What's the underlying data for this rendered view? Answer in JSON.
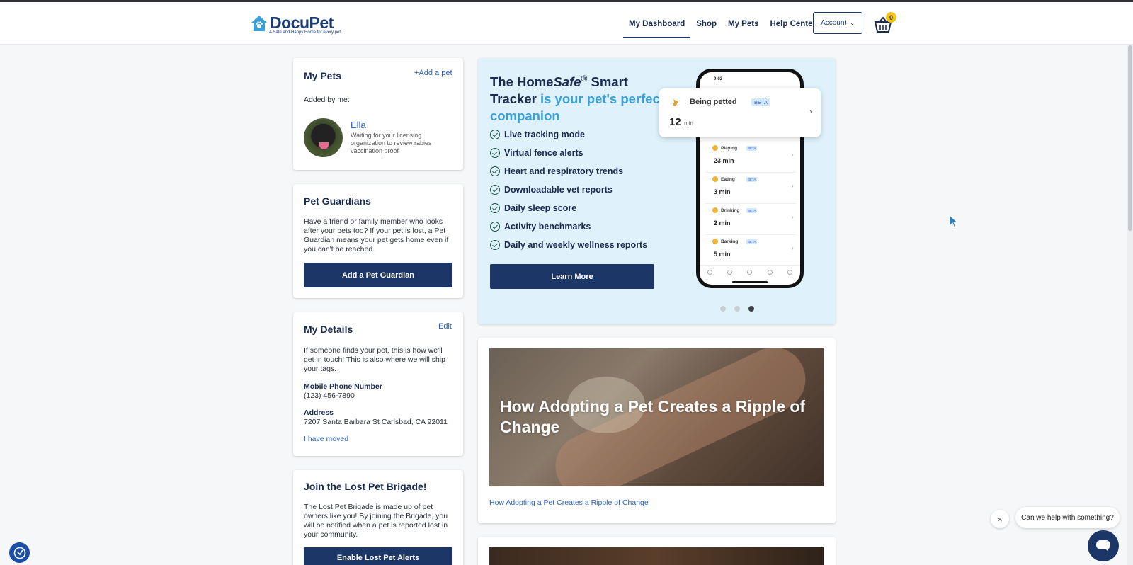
{
  "brand": {
    "name": "DocuPet",
    "tagline": "A Safe and Happy Home for every pet"
  },
  "nav": {
    "items": [
      {
        "label": "My Dashboard",
        "active": true
      },
      {
        "label": "Shop"
      },
      {
        "label": "My Pets"
      },
      {
        "label": "Help Center"
      }
    ],
    "account_label": "Account",
    "cart_count": "0"
  },
  "my_pets": {
    "title": "My Pets",
    "add_link": "+Add a pet",
    "added_by": "Added by me:",
    "pet": {
      "name": "Ella",
      "status": "Waiting for your licensing organization to review rabies vaccination proof"
    }
  },
  "guardians": {
    "title": "Pet Guardians",
    "body": "Have a friend or family member who looks after your pets too? If your pet is lost, a Pet Guardian means your pet gets home even if you can't be reached.",
    "button": "Add a Pet Guardian"
  },
  "details": {
    "title": "My Details",
    "edit": "Edit",
    "body": "If someone finds your pet, this is how we'll get in touch! This is also where we will ship your tags.",
    "phone_label": "Mobile Phone Number",
    "phone": "(123) 456-7890",
    "address_label": "Address",
    "address": "7207 Santa Barbara St Carlsbad, CA 92011",
    "moved_link": "I have moved"
  },
  "brigade": {
    "title": "Join the Lost Pet Brigade!",
    "body": "The Lost Pet Brigade is made up of pet owners like you! By joining the Brigade, you will be notified when a pet is reported lost in your community.",
    "button": "Enable Lost Pet Alerts"
  },
  "promo": {
    "title_1": "The Home",
    "title_italic": "Safe",
    "title_sup": "®",
    "title_2": " Smart Tracker ",
    "title_accent": "is your pet's perfect companion",
    "features": [
      "Live tracking mode",
      "Virtual fence alerts",
      "Heart and respiratory trends",
      "Downloadable vet reports",
      "Daily sleep score",
      "Activity benchmarks",
      "Daily and weekly wellness reports"
    ],
    "button": "Learn More",
    "slide_count": 3,
    "active_slide": 3,
    "phone": {
      "time": "9:02",
      "popup": {
        "label": "Being petted",
        "beta": "BETA",
        "value": "12",
        "unit": "min"
      },
      "rows": [
        {
          "label": "Playing",
          "beta": "BETA",
          "value": "23 min"
        },
        {
          "label": "Eating",
          "beta": "BETA",
          "value": "3 min"
        },
        {
          "label": "Drinking",
          "beta": "BETA",
          "value": "2 min"
        },
        {
          "label": "Barking",
          "beta": "BETA",
          "value": "5 min"
        }
      ]
    }
  },
  "blog": {
    "post1_title": "How Adopting a Pet Creates a Ripple of Change",
    "post1_link": "How Adopting a Pet Creates a Ripple of Change"
  },
  "chat": {
    "prompt": "Can we help with something?"
  },
  "colors": {
    "navy": "#1d3668",
    "link": "#2c5fc1",
    "accent": "#3aa0d9",
    "promo_bg": "#dff2fc",
    "badge": "#f5c518"
  }
}
